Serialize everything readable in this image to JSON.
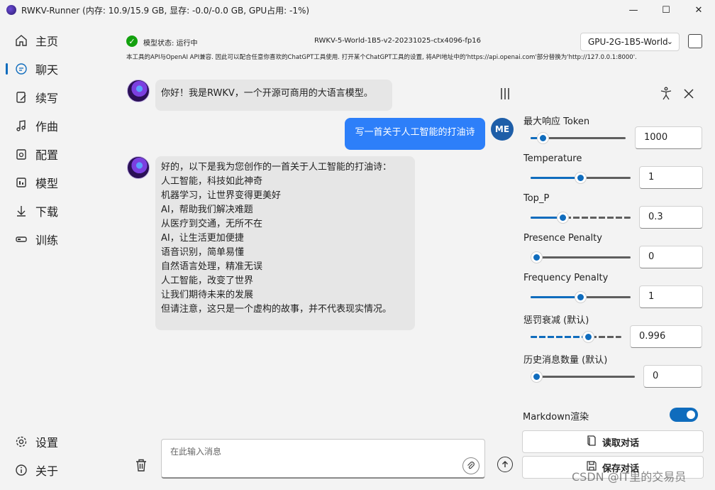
{
  "window": {
    "title": "RWKV-Runner (内存: 10.9/15.9 GB, 显存: -0.0/-0.0 GB, GPU占用: -1%)",
    "minimize": "—",
    "maximize": "☐",
    "close": "✕"
  },
  "sidebar": {
    "items": [
      {
        "label": "主页",
        "icon": "home-icon"
      },
      {
        "label": "聊天",
        "icon": "chat-icon",
        "active": true
      },
      {
        "label": "续写",
        "icon": "continue-write-icon"
      },
      {
        "label": "作曲",
        "icon": "music-icon"
      },
      {
        "label": "配置",
        "icon": "config-icon"
      },
      {
        "label": "模型",
        "icon": "model-icon"
      },
      {
        "label": "下载",
        "icon": "download-icon"
      },
      {
        "label": "训练",
        "icon": "train-icon"
      }
    ],
    "bottom": [
      {
        "label": "设置",
        "icon": "gear-icon"
      },
      {
        "label": "关于",
        "icon": "info-icon"
      }
    ]
  },
  "status": {
    "text": "模型状态: 运行中",
    "model_name": "RWKV-5-World-1B5-v2-20231025-ctx4096-fp16",
    "gpu_strategy": "GPU-2G-1B5-World",
    "notice": "本工具的API与OpenAI API兼容. 因此可以配合任意你喜欢的ChatGPT工具使用. 打开某个ChatGPT工具的设置, 将API地址中的'https://api.openai.com'部分替换为'http://127.0.0.1:8000'."
  },
  "chat": {
    "greeting": "你好！我是RWKV，一个开源可商用的大语言模型。",
    "user_avatar": "ME",
    "user_message": "写一首关于人工智能的打油诗",
    "reply_lines": [
      "好的，以下是我为您创作的一首关于人工智能的打油诗：",
      "人工智能，科技如此神奇",
      "机器学习，让世界变得更美好",
      "AI，帮助我们解决难题",
      "从医疗到交通，无所不在",
      "AI，让生活更加便捷",
      "语音识别，简单易懂",
      "自然语言处理，精准无误",
      "人工智能，改变了世界",
      "让我们期待未来的发展",
      "但请注意，这只是一个虚构的故事，并不代表现实情况。"
    ],
    "input_placeholder": "在此输入消息"
  },
  "params": [
    {
      "label": "最大响应 Token",
      "value": "1000",
      "fraction": 0.08
    },
    {
      "label": "Temperature",
      "value": "1",
      "fraction": 0.5
    },
    {
      "label": "Top_P",
      "value": "0.3",
      "fraction": 0.3
    },
    {
      "label": "Presence Penalty",
      "value": "0",
      "fraction": 0.0
    },
    {
      "label": "Frequency Penalty",
      "value": "1",
      "fraction": 0.5
    },
    {
      "label": "惩罚衰减 (默认)",
      "value": "0.996",
      "fraction": 0.66
    },
    {
      "label": "历史消息数量 (默认)",
      "value": "0",
      "fraction": 0.0
    }
  ],
  "markdown_label": "Markdown渲染",
  "markdown_on": true,
  "buttons": {
    "read": "读取对话",
    "save": "保存对话"
  },
  "watermark": "CSDN @IT里的交易员",
  "colors": {
    "accent": "#0f6cbd",
    "user_bubble": "#2d7ff9",
    "bot_bubble": "#e6e6e6",
    "status_ok": "#13a10e"
  }
}
